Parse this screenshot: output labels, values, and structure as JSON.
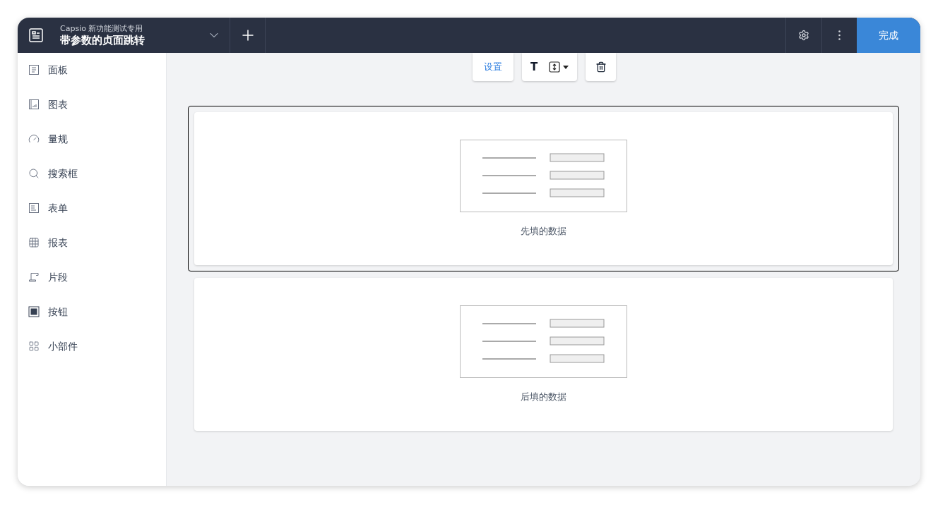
{
  "header": {
    "app_name": "Capsio 新功能测试专用",
    "page_title": "带参数的贞面跳转",
    "done_button": "完成"
  },
  "sidebar": {
    "items": [
      {
        "kind": "panel",
        "label": "面板"
      },
      {
        "kind": "chart",
        "label": "图表"
      },
      {
        "kind": "gauge",
        "label": "量规"
      },
      {
        "kind": "search",
        "label": "搜索框"
      },
      {
        "kind": "form",
        "label": "表单"
      },
      {
        "kind": "table",
        "label": "报表"
      },
      {
        "kind": "snippet",
        "label": "片段"
      },
      {
        "kind": "button",
        "label": "按钮"
      },
      {
        "kind": "widget",
        "label": "小部件"
      }
    ]
  },
  "toolbar": {
    "settings_button": "设置",
    "text_button": "T"
  },
  "forms": [
    {
      "caption": "先填的数据",
      "selected": true
    },
    {
      "caption": "后填的数据",
      "selected": false
    }
  ]
}
